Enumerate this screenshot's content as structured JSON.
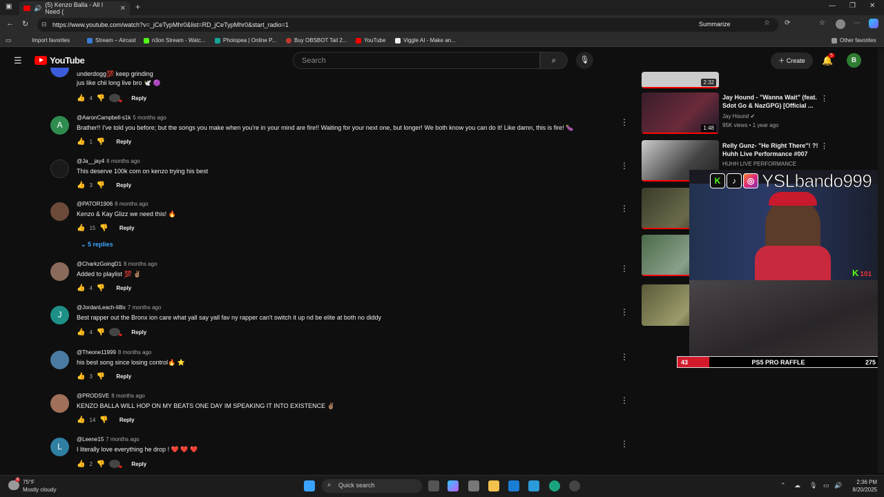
{
  "browser": {
    "tab_title": "(5) Kenzo Balla - All I Need (",
    "url": "https://www.youtube.com/watch?v=_jCeTypMhr0&list=RD_jCeTypMhr0&start_radio=1",
    "summarize_label": "Summarize",
    "bookmarks": [
      {
        "label": "Import favorites",
        "color": "#999"
      },
      {
        "label": "Stream – Aircast",
        "color": "#3a7bd5"
      },
      {
        "label": "n3on Stream - Watc...",
        "color": "#53fc18"
      },
      {
        "label": "Photopea | Online P...",
        "color": "#18a497"
      },
      {
        "label": "Buy OBSBOT Tail 2...",
        "color": "#c0392b"
      },
      {
        "label": "YouTube",
        "color": "#ff0000"
      },
      {
        "label": "Viggle AI - Make an...",
        "color": "#eee"
      }
    ],
    "other_favorites": "Other favorites"
  },
  "youtube": {
    "logo_text": "YouTube",
    "search_placeholder": "Search",
    "create_label": "Create",
    "notification_count": "5",
    "avatar_letter": "B"
  },
  "comments": [
    {
      "author": "",
      "time": "",
      "text": "jus like chii long live bro 🕊️ 🟣",
      "pre": "underdogg💯 keep grinding",
      "likes": "4",
      "avatar_letter": "",
      "avatar_color": "#3b5bdb",
      "hearted": true
    },
    {
      "author": "@AaronCampbell-s1k",
      "time": "5 months ago",
      "text": "Brather!! I've told you before; but the songs you make when you're in your mind are fire!! Waiting for your next one, but longer! We both know you can do it! Like damn, this is fire! 🍆",
      "likes": "1",
      "avatar_letter": "A",
      "avatar_color": "#2f8c4f",
      "hearted": false
    },
    {
      "author": "@Ja__jay4",
      "time": "8 months ago",
      "text": "This deserve 100k com on kenzo trying his best",
      "likes": "3",
      "avatar_letter": "",
      "avatar_color": "#1a1a1a",
      "hearted": false
    },
    {
      "author": "@PATOR1906",
      "time": "8 months ago",
      "text": "Kenzo & Kay Glizz we need this! 🔥",
      "likes": "15",
      "avatar_letter": "",
      "avatar_color": "#6b4a3a",
      "hearted": false
    },
    {
      "author": "@CharkzGoingD1",
      "time": "8 months ago",
      "text": "Added to playlist 💯 ✌🏽",
      "likes": "4",
      "avatar_letter": "",
      "avatar_color": "#8a6a5a",
      "hearted": false
    },
    {
      "author": "@JordanLeach-li8lx",
      "time": "7 months ago",
      "text": "Best rapper out the Bronx ion care what yall say yall fav ny rapper can't switch it up nd be elite at both no diddy",
      "likes": "4",
      "avatar_letter": "J",
      "avatar_color": "#1e8f87",
      "hearted": true
    },
    {
      "author": "@Theone11999",
      "time": "8 months ago",
      "text": "his best song since losing control🔥 ⭐",
      "likes": "3",
      "avatar_letter": "",
      "avatar_color": "#4a7aa0",
      "hearted": false
    },
    {
      "author": "@PRODSVE",
      "time": "8 months ago",
      "text": "KENZO BALLA WILL HOP ON MY BEATS ONE DAY IM SPEAKING IT INTO EXISTENCE ✌🏽",
      "likes": "14",
      "avatar_letter": "",
      "avatar_color": "#a0705a",
      "hearted": false
    },
    {
      "author": "@Leene15",
      "time": "7 months ago",
      "text": "I literally love everything he drop ! ❤️ ❤️ ❤️",
      "likes": "2",
      "avatar_letter": "L",
      "avatar_color": "#2f7fa3",
      "hearted": true
    }
  ],
  "replies_label": "5 replies",
  "reply_label": "Reply",
  "sidebar_videos": [
    {
      "title": "",
      "channel": "",
      "meta": "",
      "duration": "2:32"
    },
    {
      "title": "Jay Hound - \"Wanna Wait\" (feat. Sdot Go & NazGPG) [Official ...",
      "channel": "Jay Hound",
      "meta": "95K views • 1 year ago",
      "duration": "1:48"
    },
    {
      "title": "Relly Gunz- \"He Right There\"! ?! Huhh Live Performance #007",
      "channel": "HUHH LIVE PERFORMANCE",
      "meta": "",
      "duration": ""
    }
  ],
  "stream_overlay": {
    "handle": "YSLbando999",
    "kick_count": "101",
    "raffle_label": "PS5 PRO RAFFLE",
    "raffle_current": "43",
    "raffle_goal": "275",
    "raffle_fraction": 0.156
  },
  "taskbar": {
    "weather_temp": "75°F",
    "weather_cond": "Mostly cloudy",
    "weather_badge": "6",
    "search_placeholder": "Quick search",
    "time": "2:36 PM",
    "date": "8/20/2025"
  }
}
